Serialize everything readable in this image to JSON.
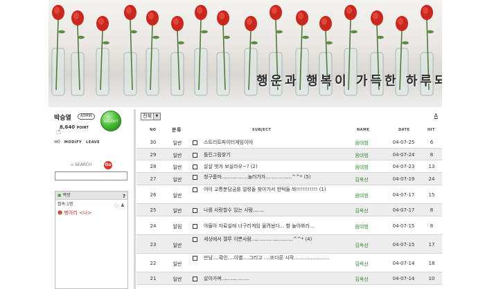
{
  "banner": {
    "caption": "행운과 행복이 가득한 하루되시길..."
  },
  "user": {
    "name": "박승열",
    "badge": "ADMIN",
    "logout_label": "LOGOUT",
    "points": "8,640",
    "points_unit": "POINT",
    "mail_count": "0",
    "modify_label": "MODIFY",
    "leave_label": "LEAVE"
  },
  "search": {
    "label": "SEARCH",
    "go_label": "Go"
  },
  "chat": {
    "title": "쪽방",
    "help": "?",
    "count": "접속:1명",
    "user": "병아리 <나>"
  },
  "board": {
    "category_selected": "전체",
    "top_link": "A",
    "headers": {
      "no": "NO",
      "category": "분류",
      "subject": "SUBJECT",
      "name": "NAME",
      "date": "DATE",
      "hit": "HIT"
    },
    "rows": [
      {
        "no": "30",
        "category": "일반",
        "subject": "스트리트파이터게임이야",
        "comments": "",
        "name": "음대범",
        "date": "04-07-25",
        "hit": "6"
      },
      {
        "no": "29",
        "category": "일반",
        "subject": "틀린그림찾기",
        "comments": "",
        "name": "음대범",
        "date": "04-07-24",
        "hit": "8"
      },
      {
        "no": "28",
        "category": "일반",
        "subject": "살살 벗겨 보실라우~?",
        "comments": "(2)",
        "name": "음대범",
        "date": "04-07-23",
        "hit": "13"
      },
      {
        "no": "27",
        "category": "일반",
        "subject": "청구룸마.................놀러가자.................^^*",
        "comments": "(5)",
        "name": "김옥선",
        "date": "04-07-19",
        "hit": "24"
      },
      {
        "no": "26",
        "category": "일반",
        "subject": "어이 교통분담금를 얼렁들 찾아가서 한턱들 쏴!!!!!!!!!!!",
        "comments": "(1)",
        "name": "음대범",
        "date": "04-07-17",
        "hit": "15"
      },
      {
        "no": "25",
        "category": "일반",
        "subject": "나를 사랑할수 있는 사람.......",
        "comments": "",
        "name": "김옥선",
        "date": "04-07-17",
        "hit": "8"
      },
      {
        "no": "24",
        "category": "알림",
        "subject": "야들아 자료실에 너구리게임 올려놨다... 함 놀아봐라...",
        "comments": "",
        "name": "음대범",
        "date": "04-07-15",
        "hit": "8"
      },
      {
        "no": "23",
        "category": "일반",
        "subject": "세상에서 젤루 이쁜사람...........................^^*",
        "comments": "(4)",
        "name": "김옥선",
        "date": "04-07-15",
        "hit": "17"
      },
      {
        "no": "22",
        "category": "일반",
        "subject": "만남....확인....이별....그리고 ....또다른 시작.......................",
        "comments": "",
        "name": "김옥선",
        "date": "04-07-14",
        "hit": "18"
      },
      {
        "no": "21",
        "category": "일반",
        "subject": "살아가며..................",
        "comments": "",
        "name": "김옥선",
        "date": "04-07-14",
        "hit": "10"
      }
    ]
  }
}
